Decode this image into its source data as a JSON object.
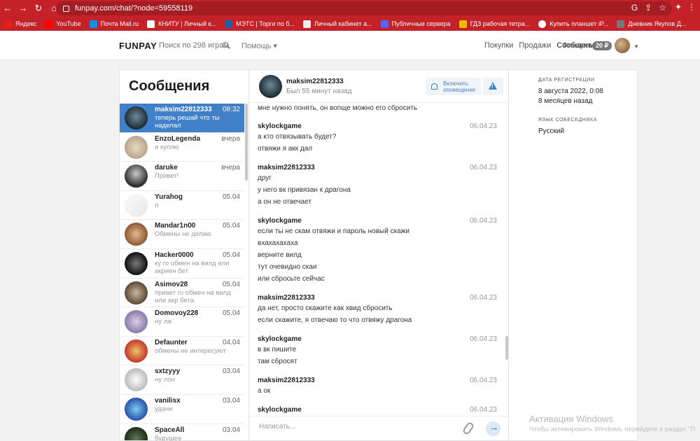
{
  "browser": {
    "url": "funpay.com/chat/?node=59558119",
    "bookmarks": [
      "Яндекс",
      "YouTube",
      "Почта Mail.ru",
      "КНИТУ | Личный к...",
      "МЭТС | Торги по б...",
      "Личный кабинет а...",
      "Публичные сервера",
      "ГДЗ рабочая тетра...",
      "Купить планшет iP...",
      "Дневник Якупов Д..."
    ]
  },
  "header": {
    "logo": "FUNPAY",
    "search": "Поиск по 298 играм",
    "help": "Помощь",
    "nav": [
      "Покупки",
      "Продажи",
      "Сообщения"
    ],
    "finance": "Финансы",
    "balance": "20 ₽"
  },
  "left": {
    "title": "Сообщения",
    "contacts": [
      {
        "name": "maksim22812333",
        "time": "08:32",
        "last": "теперь решай что ты наделал"
      },
      {
        "name": "EnzoLegenda",
        "time": "вчера",
        "last": "и куплю"
      },
      {
        "name": "daruke",
        "time": "вчера",
        "last": "Привет!"
      },
      {
        "name": "Yurahog",
        "time": "05.04",
        "last": "л"
      },
      {
        "name": "Mandar1n00",
        "time": "05.04",
        "last": "Обмены не делаю"
      },
      {
        "name": "Hacker0000",
        "time": "05.04",
        "last": "ку го обмен на вилд или акриен бет"
      },
      {
        "name": "Asimov28",
        "time": "05.04",
        "last": "привет го обмен на вилд или акр бета"
      },
      {
        "name": "Domovoy228",
        "time": "05.04",
        "last": "ну лж"
      },
      {
        "name": "Defaunter",
        "time": "04.04",
        "last": "обмены не интересуют"
      },
      {
        "name": "sxtzyyy",
        "time": "03.04",
        "last": "ну лон"
      },
      {
        "name": "vanilisx",
        "time": "03.04",
        "last": "удачи"
      },
      {
        "name": "SpaceAll",
        "time": "03.04",
        "last": "будущее"
      }
    ]
  },
  "chat": {
    "name": "maksim22812333",
    "seen": "Был 55 минут назад",
    "notify": "Включить оповещения",
    "first_line": "мне нужно понять, он вопще можно его сбросить",
    "groups": [
      {
        "author": "skylockgame",
        "date": "06.04.23",
        "lines": [
          "а кто отвязывать будет?",
          "отвяжи я акк дал"
        ]
      },
      {
        "author": "maksim22812333",
        "date": "06.04.23",
        "lines": [
          "друг",
          "у него вк привязан к драгона",
          "а он не отвечает"
        ]
      },
      {
        "author": "skylockgame",
        "date": "06.04.23",
        "lines": [
          "если ты не скам отвяжи и пароль новый скажи",
          "вхахахахаха",
          "верните вилд",
          "тут очевидно скаи",
          "или сбросьте сейчас"
        ]
      },
      {
        "author": "maksim22812333",
        "date": "06.04.23",
        "lines": [
          "да нет, просто скажите как хвид сбросить",
          "если скажите, я отвечаю то что отвяжу драгона"
        ]
      },
      {
        "author": "skylockgame",
        "date": "06.04.23",
        "lines": [
          "в вк пишите",
          "там сбросят"
        ]
      },
      {
        "author": "maksim22812333",
        "date": "06.04.23",
        "lines": [
          "а ок"
        ]
      },
      {
        "author": "skylockgame",
        "date": "06.04.23",
        "lines": []
      }
    ],
    "placeholder": "Написать..."
  },
  "right": {
    "reg_label": "ДАТА РЕГИСТРАЦИИ",
    "reg_date": "8 августа 2022, 0:08",
    "reg_ago": "8 месяцев назад",
    "lang_label": "ЯЗЫК СОБЕСЕДНИКА",
    "lang": "Русский"
  },
  "watermark": {
    "title": "Активация Windows",
    "text": "Чтобы активировать Windows, перейдите в раздел \"П"
  }
}
